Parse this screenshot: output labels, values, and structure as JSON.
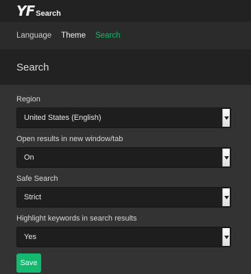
{
  "brand": {
    "mark": "YF",
    "word": "Search"
  },
  "nav": {
    "language": "Language",
    "theme": "Theme",
    "search": "Search"
  },
  "header": {
    "title": "Search"
  },
  "form": {
    "region": {
      "label": "Region",
      "value": "United States (English)"
    },
    "new_window": {
      "label": "Open results in new window/tab",
      "value": "On"
    },
    "safe_search": {
      "label": "Safe Search",
      "value": "Strict"
    },
    "highlight": {
      "label": "Highlight keywords in search results",
      "value": "Yes"
    },
    "save_label": "Save"
  },
  "colors": {
    "accent": "#14b86e",
    "background": "#333333",
    "bar": "#222222"
  }
}
